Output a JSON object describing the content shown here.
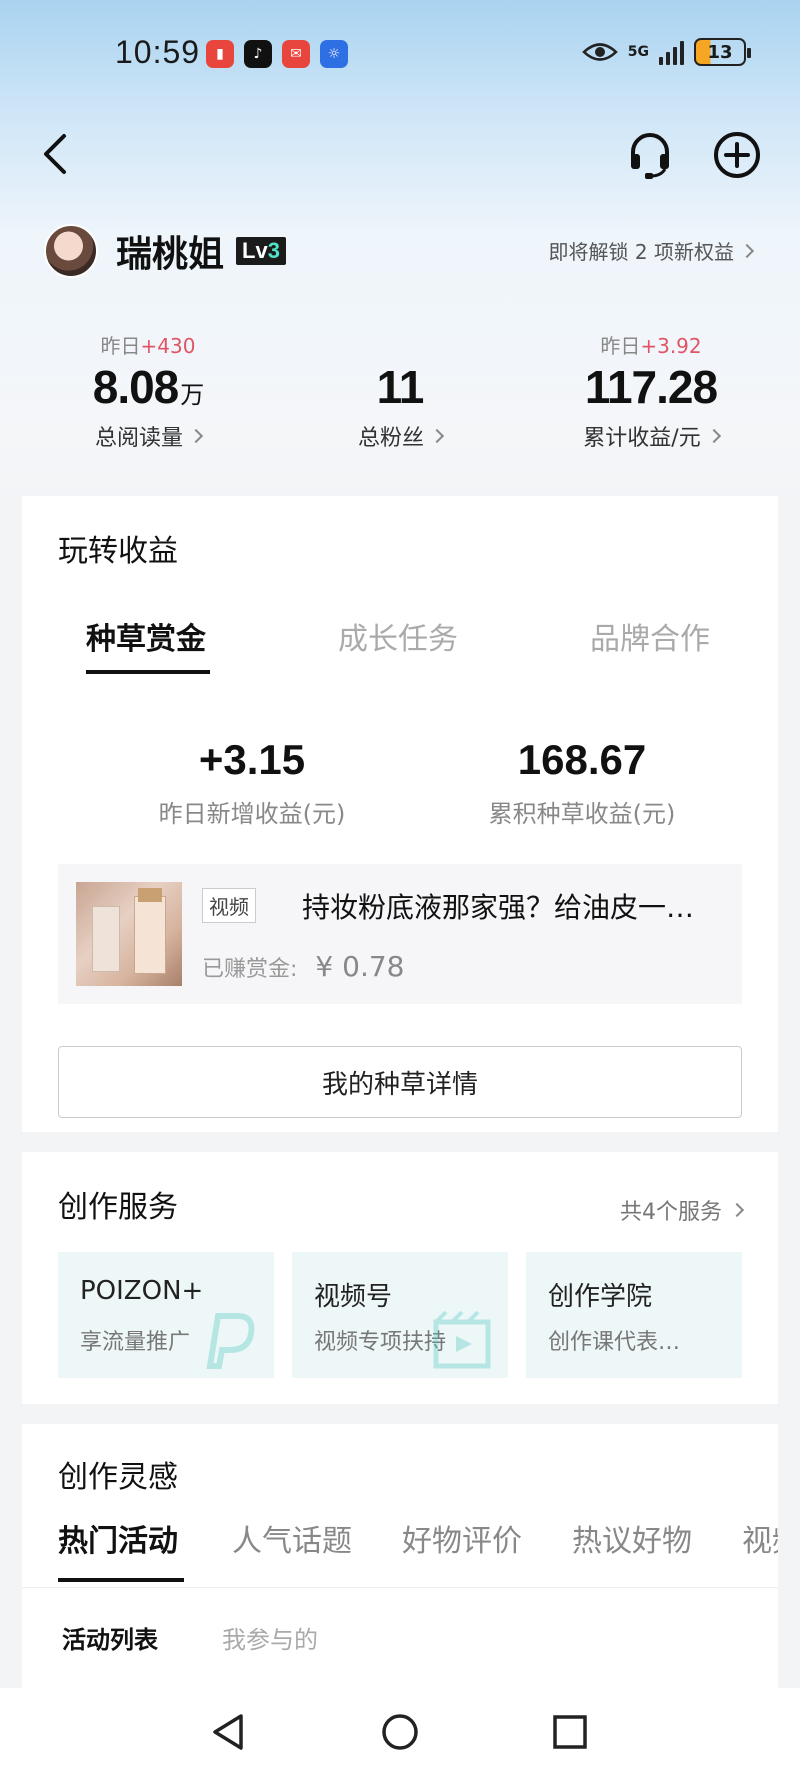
{
  "status_bar": {
    "time": "10:59",
    "network": "5G",
    "battery": "13",
    "app_icons": [
      "battery-saver-icon",
      "tiktok-icon",
      "mail-icon",
      "bulb-icon"
    ]
  },
  "profile": {
    "name": "瑞桃姐",
    "level_prefix": "Lv",
    "level_num": "3",
    "unlock_text": "即将解锁 2 项新权益"
  },
  "stats": {
    "reads": {
      "delta_prefix": "昨日",
      "delta": "+430",
      "value": "8.08",
      "unit": "万",
      "label": "总阅读量"
    },
    "fans": {
      "value": "11",
      "label": "总粉丝"
    },
    "income": {
      "delta_prefix": "昨日",
      "delta": "+3.92",
      "value": "117.28",
      "label": "累计收益/元"
    }
  },
  "earnings_card": {
    "title": "玩转收益",
    "tabs": [
      {
        "label": "种草赏金",
        "active": true
      },
      {
        "label": "成长任务",
        "active": false
      },
      {
        "label": "品牌合作",
        "active": false
      }
    ],
    "yesterday": {
      "value": "+3.15",
      "label": "昨日新增收益(元)"
    },
    "total": {
      "value": "168.67",
      "label": "累积种草收益(元)"
    },
    "item": {
      "tag": "视频",
      "title": "持妆粉底液那家强？给油皮一…",
      "earned_label": "已赚赏金:",
      "earned_amount": "¥ 0.78"
    },
    "detail_button": "我的种草详情"
  },
  "services_card": {
    "title": "创作服务",
    "count_text": "共4个服务",
    "items": [
      {
        "title": "POIZON+",
        "subtitle": "享流量推广",
        "icon": "poizon-icon"
      },
      {
        "title": "视频号",
        "subtitle": "视频专项扶持",
        "icon": "video-icon"
      },
      {
        "title": "创作学院",
        "subtitle": "创作课代表…",
        "icon": "academy-icon"
      }
    ]
  },
  "inspiration_card": {
    "title": "创作灵感",
    "tabs": [
      {
        "label": "热门活动",
        "active": true
      },
      {
        "label": "人气话题",
        "active": false
      },
      {
        "label": "好物评价",
        "active": false
      },
      {
        "label": "热议好物",
        "active": false
      },
      {
        "label": "视频",
        "active": false
      }
    ],
    "subtabs": [
      {
        "label": "活动列表",
        "active": true
      },
      {
        "label": "我参与的",
        "active": false
      }
    ]
  },
  "colors": {
    "accent_red": "#e05566",
    "level_accent": "#4fe3c7",
    "battery_orange": "#f6a623"
  }
}
